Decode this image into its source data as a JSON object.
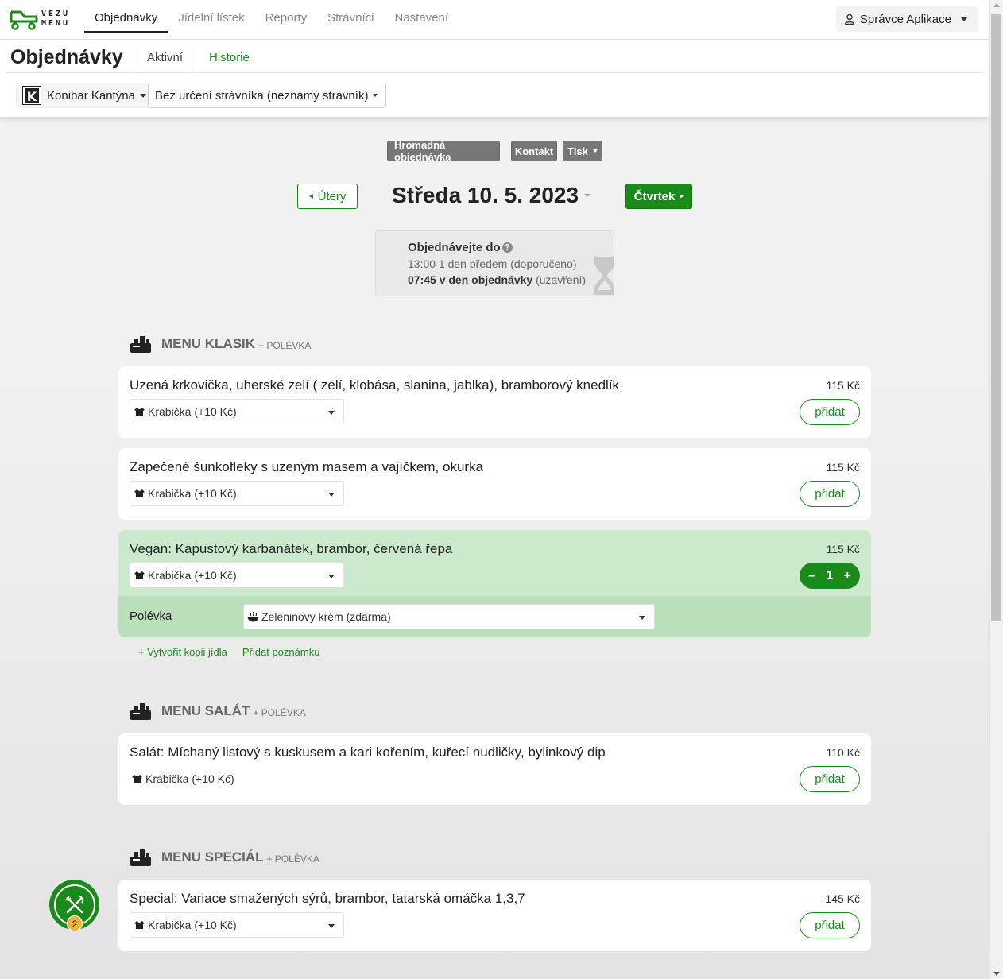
{
  "brand": {
    "logo_text_top": "VEZU",
    "logo_text_bottom": "MENU",
    "accent": "#1a8a1a"
  },
  "nav": {
    "items": [
      {
        "label": "Objednávky",
        "active": true
      },
      {
        "label": "Jídelní lístek"
      },
      {
        "label": "Reporty"
      },
      {
        "label": "Strávníci"
      },
      {
        "label": "Nastavení"
      }
    ],
    "user": "Správce Aplikace"
  },
  "subheader": {
    "title": "Objednávky",
    "tabs": [
      {
        "label": "Aktivní"
      },
      {
        "label": "Historie"
      }
    ],
    "canteen": "Konibar Kantýna",
    "canteen_logo": "K",
    "diner": "Bez určení strávníka (neznámý strávník)"
  },
  "actions": {
    "bulk": "Hromadná objednávka",
    "contact": "Kontakt",
    "print": "Tisk"
  },
  "date_nav": {
    "prev": "Úterý",
    "current": "Středa 10. 5. 2023",
    "next": "Čtvrtek"
  },
  "deadline": {
    "title": "Objednávejte do",
    "help": "?",
    "line1": "13:00 1 den předem (doporučeno)",
    "line2_bold": "07:45 v den objednávky",
    "line2_rest": " (uzavření)"
  },
  "sections": [
    {
      "name": "MENU KLASIK",
      "sub": "+ POLÉVKA",
      "meals": [
        {
          "name": "Uzená krkovička, uherské zelí ( zelí, klobása, slanina, jablka), bramborový knedlík",
          "price": "115 Kč",
          "package": "Krabička (+10 Kč)",
          "action": "přidat"
        },
        {
          "name": "Zapečené šunkofleky s uzeným masem a vajíčkem, okurka",
          "price": "115 Kč",
          "package": "Krabička (+10 Kč)",
          "action": "přidat"
        },
        {
          "name": "Vegan: Kapustový karbanátek, brambor, červená řepa",
          "price": "115 Kč",
          "package": "Krabička (+10 Kč)",
          "quantity": "1",
          "minus": "–",
          "plus": "+",
          "soup_label": "Polévka",
          "soup_value": "Zeleninový krém (zdarma)"
        }
      ],
      "links": {
        "copy": "+ Vytvořit kopii jídla",
        "note": "Přidat poznámku"
      }
    },
    {
      "name": "MENU SALÁT",
      "sub": "+ POLÉVKA",
      "meals": [
        {
          "name": "Salát: Míchaný listový s kuskusem a kari kořením, kuřecí nudličky, bylinkový dip",
          "price": "110 Kč",
          "package": "Krabička (+10 Kč)",
          "action": "přidat"
        }
      ]
    },
    {
      "name": "MENU SPECIÁL",
      "sub": "+ POLÉVKA",
      "meals": [
        {
          "name": "Special: Variace smažených sýrů, brambor, tatarská omáčka 1,3,7",
          "price": "145 Kč",
          "package": "Krabička (+10 Kč)",
          "action": "přidat"
        }
      ]
    }
  ],
  "cart": {
    "count": "2"
  }
}
